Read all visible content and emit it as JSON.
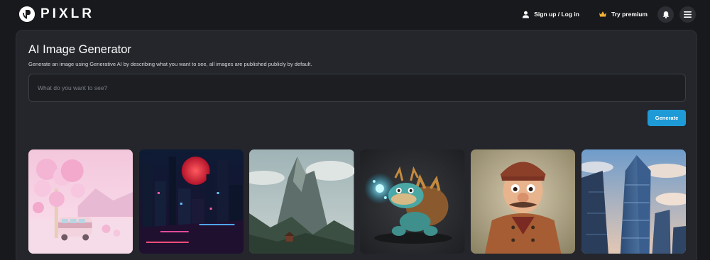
{
  "header": {
    "logo_text": "PIXLR",
    "signup_label": "Sign up / Log in",
    "premium_label": "Try premium",
    "icons": [
      "user-icon",
      "crown-icon",
      "bell-icon",
      "menu-icon"
    ]
  },
  "generator": {
    "title": "AI Image Generator",
    "subtitle": "Generate an image using Generative AI by describing what you want to see, all images are published publicly by default.",
    "prompt_placeholder": "What do you want to see?",
    "prompt_value": "",
    "generate_label": "Generate"
  },
  "colors": {
    "page_bg": "#18191c",
    "panel_bg": "#24262b",
    "accent": "#1e9ad6",
    "crown": "#f2b233"
  },
  "gallery": {
    "images": [
      {
        "subject": "pastel trees and pink camper van"
      },
      {
        "subject": "neon city under red moon"
      },
      {
        "subject": "misty mountain peak with forest"
      },
      {
        "subject": "turtle monster with glowing blue magic"
      },
      {
        "subject": "cartoon man in brown coat and hat"
      },
      {
        "subject": "glass skyscraper against cloudy sky"
      }
    ]
  }
}
